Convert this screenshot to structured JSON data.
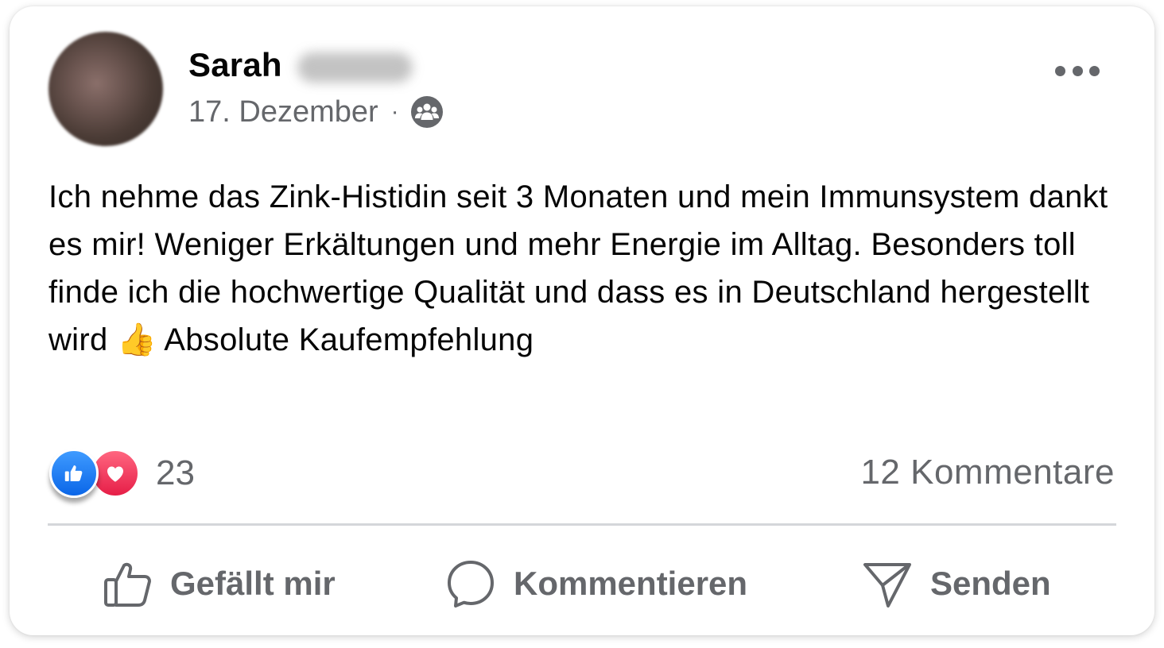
{
  "post": {
    "author_first_name": "Sarah",
    "date": "17. Dezember",
    "separator": "·",
    "audience_icon": "friends-icon",
    "text": "Ich nehme das Zink-Histidin seit 3 Monaten und mein Immunsystem dankt es mir! Weniger Erkältungen und mehr Energie im Alltag. Besonders toll finde ich die hochwertige Qualität und dass es in Deutschland hergestellt wird 👍 Absolute Kaufempfehlung"
  },
  "stats": {
    "reaction_icons": [
      "like-icon",
      "love-icon"
    ],
    "reaction_count": "23",
    "comment_count": "12 Kommentare"
  },
  "actions": {
    "like_label": "Gefällt mir",
    "comment_label": "Kommentieren",
    "send_label": "Senden"
  },
  "colors": {
    "like_blue": "#0a66e8",
    "love_red": "#e61e47",
    "secondary_text": "#65676b",
    "primary_text": "#050505"
  }
}
